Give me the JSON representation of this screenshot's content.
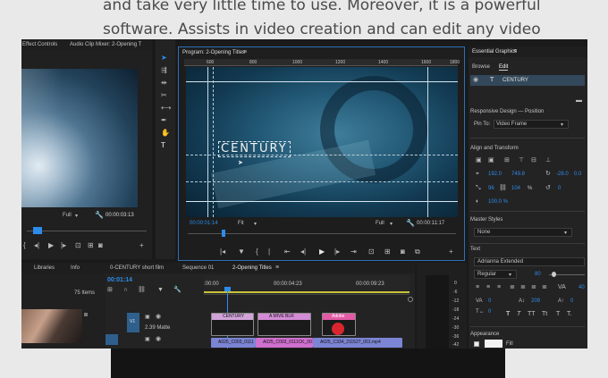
{
  "background_text": {
    "line1": "and take very little time to use. Moreover, it is a powerful",
    "line2": "software. Assists in video creation and can edit any video"
  },
  "source_panel": {
    "tabs": [
      "Effect Controls",
      "Audio Clip Mixer: 2-Opening T"
    ],
    "zoom": "Full",
    "timecode": "00:00:03:13"
  },
  "program_monitor": {
    "title": "Program: 2-Opening Titles",
    "menu_icon": "hamburger-icon",
    "ruler_labels": [
      "600",
      "800",
      "1000",
      "1200",
      "1400",
      "1600",
      "1800"
    ],
    "overlay_text": "CENTURY",
    "timecode_left": "00:00:01:14",
    "fit_label": "Fit",
    "quality_label": "Full",
    "timecode_right": "00:00:11:17"
  },
  "essential_graphics": {
    "title": "Essential Graphics",
    "tabs": [
      "Browse",
      "Edit"
    ],
    "layer_name": "CENTURY",
    "responsive_heading": "Responsive Design — Position",
    "pin_to_label": "Pin To:",
    "pin_to_value": "Video Frame",
    "align_heading": "Align and Transform",
    "pos_x": "192.0",
    "pos_y": "749.8",
    "rotation": "-28.0",
    "anchor": "0.0",
    "scale_w": "96",
    "scale_h": "104",
    "scale_unit": "%",
    "rot_value": "0",
    "opacity": "100.0 %",
    "master_styles_heading": "Master Styles",
    "master_styles_value": "None",
    "text_heading": "Text",
    "font_name": "Adrianna Extended",
    "font_style": "Regular",
    "font_size": "80",
    "tracking_value": "40",
    "kerning_value": "0",
    "leading_value": "209",
    "baseline_value": "0",
    "tsume_value": "0",
    "text_styles": [
      "T",
      "T",
      "TT",
      "Tt",
      "T",
      "T."
    ],
    "appearance_heading": "Appearance",
    "fill_label": "Fill"
  },
  "tools": [
    "selection-tool",
    "track-select-tool",
    "ripple-edit-tool",
    "razor-tool",
    "slip-tool",
    "pen-tool",
    "hand-tool",
    "type-tool"
  ],
  "project_panel": {
    "tabs": [
      "Libraries",
      "Info"
    ],
    "items_count": "75 Items"
  },
  "timeline": {
    "tabs": [
      "0-CENTURY short film",
      "Sequence 01",
      "2-Opening Titles"
    ],
    "timecode": "00:01:14",
    "ruler_labels": [
      ":00:00",
      "00:00:04:23",
      "00:00:09:23"
    ],
    "track_v_label": "V1",
    "matte_label": "2.39 Matte",
    "clips_v": [
      "CENTURY",
      "A MIVE BLR",
      "Adobe"
    ],
    "clips_a": [
      "A025_C003_0111",
      "A025_C003_0111CK_001",
      "A025_C334_211527_001.mp4"
    ],
    "meter_labels": [
      "0",
      "-6",
      "-12",
      "-18",
      "-24",
      "-30",
      "-36",
      "-42"
    ]
  }
}
